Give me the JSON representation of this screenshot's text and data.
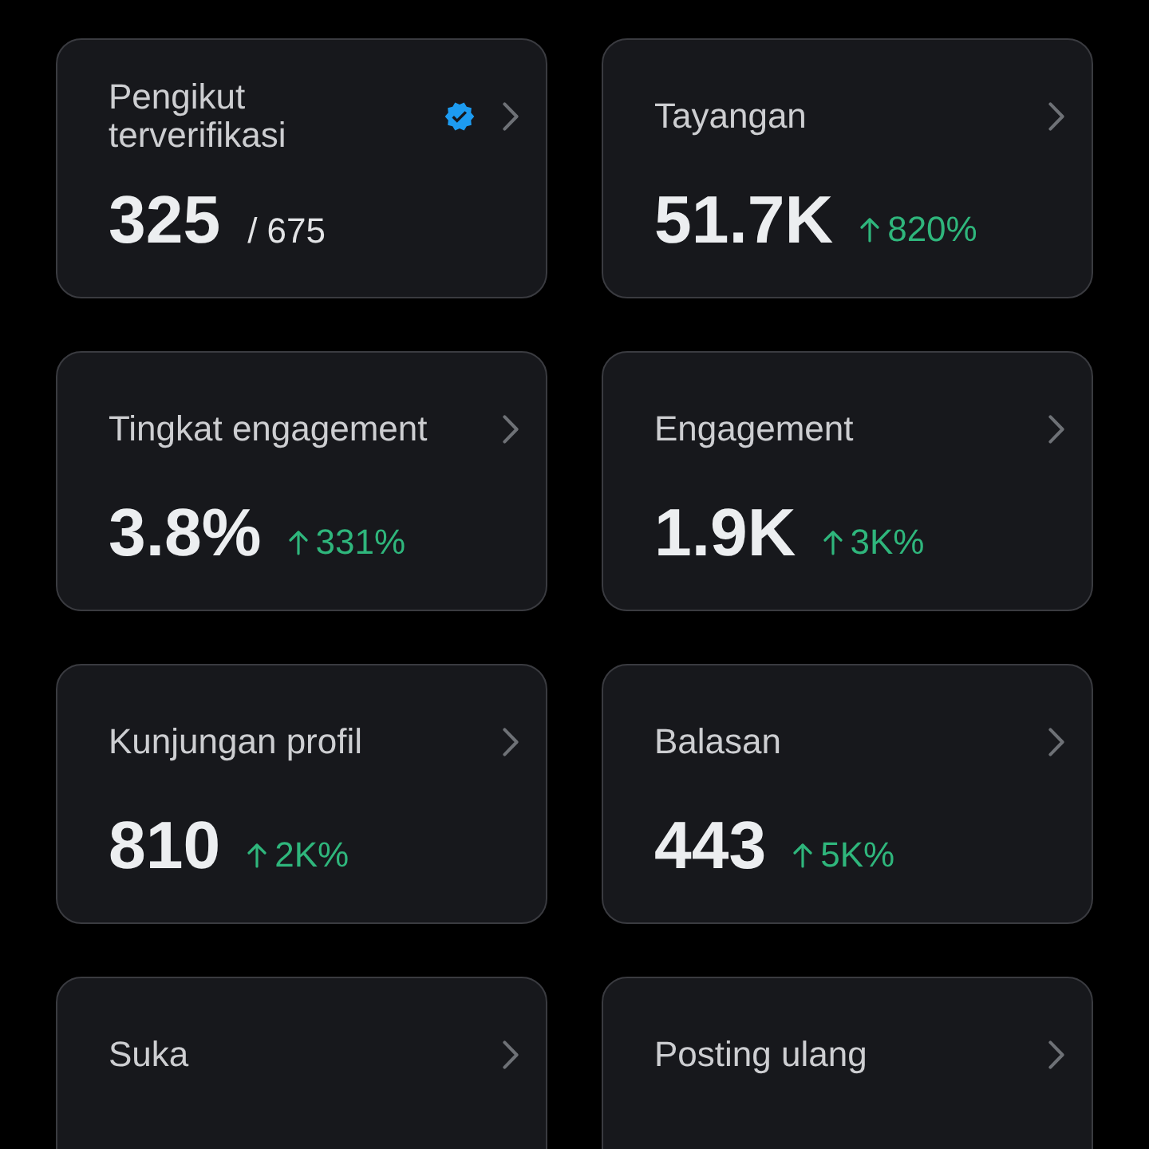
{
  "cards": [
    {
      "label": "Pengikut terverifikasi",
      "verified": true,
      "value": "325",
      "total": "/ 675"
    },
    {
      "label": "Tayangan",
      "verified": false,
      "value": "51.7K",
      "change": {
        "kind": "increase",
        "text": "820%"
      }
    },
    {
      "label": "Tingkat engagement",
      "verified": false,
      "value": "3.8%",
      "change": {
        "kind": "increase",
        "text": "331%"
      }
    },
    {
      "label": "Engagement",
      "verified": false,
      "value": "1.9K",
      "change": {
        "kind": "increase",
        "text": "3K%"
      }
    },
    {
      "label": "Kunjungan profil",
      "verified": false,
      "value": "810",
      "change": {
        "kind": "increase",
        "text": "2K%"
      }
    },
    {
      "label": "Balasan",
      "verified": false,
      "value": "443",
      "change": {
        "kind": "increase",
        "text": "5K%"
      }
    },
    {
      "label": "Suka",
      "verified": false
    },
    {
      "label": "Posting ulang",
      "verified": false
    }
  ]
}
